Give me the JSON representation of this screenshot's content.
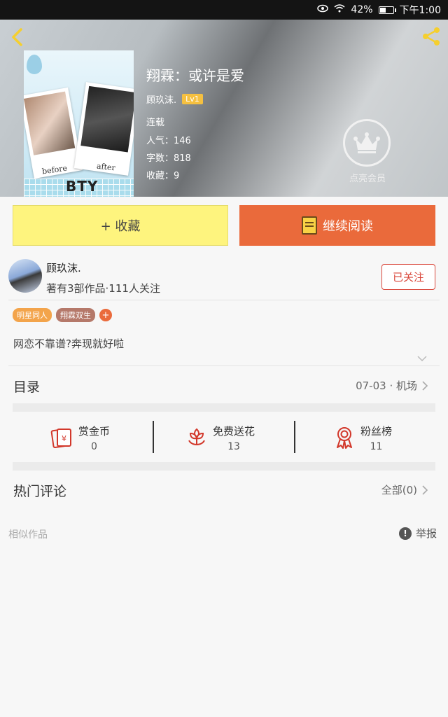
{
  "status_bar": {
    "battery": "42%",
    "time": "下午1:00",
    "battery_level": 0.42
  },
  "book": {
    "title": "翔霖：或许是爱",
    "author": "顾玖沫.",
    "level": "Lv1",
    "status": "连载",
    "popularity": "人气：146",
    "word_count": "字数：818",
    "favorites": "收藏：9",
    "cover": {
      "caption_left": "before",
      "caption_right": "after",
      "brand": "BTY"
    }
  },
  "vip": {
    "label": "点亮会员"
  },
  "actions": {
    "favorite_label": "+ 收藏",
    "read_label": "继续阅读"
  },
  "author_card": {
    "name": "顾玖沫.",
    "meta": "著有3部作品·111人关注",
    "follow_label": "已关注"
  },
  "tags": [
    "明星同人",
    "翔霖双生"
  ],
  "tag_add": "+",
  "description": "网恋不靠谱?奔现就好啦",
  "catalog": {
    "label": "目录",
    "latest": "07-03 · 机场"
  },
  "stats": [
    {
      "label": "赏金币",
      "value": "0",
      "icon": "red-envelope-icon"
    },
    {
      "label": "免费送花",
      "value": "13",
      "icon": "flower-icon"
    },
    {
      "label": "粉丝榜",
      "value": "11",
      "icon": "ribbon-medal-icon"
    }
  ],
  "comments": {
    "label": "热门评论",
    "all": "全部(0)"
  },
  "footer": {
    "similar": "相似作品",
    "report": "举报"
  },
  "colors": {
    "accent_orange": "#ea6a3b",
    "favorite_yellow": "#fef47e",
    "follow_red": "#d9473b",
    "icon_red": "#d2382b"
  }
}
